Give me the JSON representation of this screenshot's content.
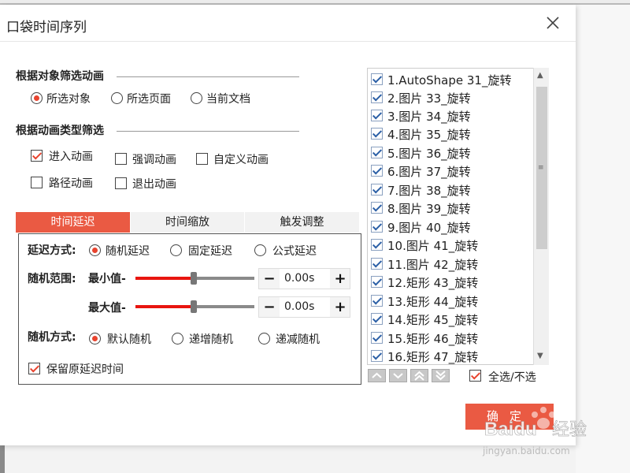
{
  "dialog": {
    "title": "口袋时间序列"
  },
  "filter_object": {
    "title": "根据对象筛选动画",
    "options": [
      "所选对象",
      "所选页面",
      "当前文档"
    ],
    "selected_index": 0
  },
  "filter_type": {
    "title": "根据动画类型筛选",
    "options": [
      {
        "label": "进入动画",
        "checked": true
      },
      {
        "label": "强调动画",
        "checked": false
      },
      {
        "label": "自定义动画",
        "checked": false
      },
      {
        "label": "路径动画",
        "checked": false
      },
      {
        "label": "退出动画",
        "checked": false
      }
    ]
  },
  "tabs": [
    {
      "label": "时间延迟",
      "active": true
    },
    {
      "label": "时间缩放",
      "active": false
    },
    {
      "label": "触发调整",
      "active": false
    }
  ],
  "delay_panel": {
    "delay_mode_label": "延迟方式:",
    "delay_modes": [
      "随机延迟",
      "固定延迟",
      "公式延迟"
    ],
    "delay_mode_selected": 0,
    "range_label": "随机范围:",
    "min_label": "最小值-",
    "max_label": "最大值-",
    "min_value": "0.00s",
    "max_value": "0.00s",
    "min_slider_fraction": 0.5,
    "max_slider_fraction": 0.5,
    "minus": "−",
    "plus": "+",
    "random_mode_label": "随机方式:",
    "random_modes": [
      "默认随机",
      "递增随机",
      "递减随机"
    ],
    "random_mode_selected": 0,
    "keep_original_label": "保留原延迟时间",
    "keep_original_checked": true
  },
  "animation_list": {
    "items": [
      {
        "label": "1.AutoShape  31_旋转",
        "checked": true
      },
      {
        "label": "2.图片 33_旋转",
        "checked": true
      },
      {
        "label": "3.图片 34_旋转",
        "checked": true
      },
      {
        "label": "4.图片 35_旋转",
        "checked": true
      },
      {
        "label": "5.图片 36_旋转",
        "checked": true
      },
      {
        "label": "6.图片 37_旋转",
        "checked": true
      },
      {
        "label": "7.图片 38_旋转",
        "checked": true
      },
      {
        "label": "8.图片 39_旋转",
        "checked": true
      },
      {
        "label": "9.图片 40_旋转",
        "checked": true
      },
      {
        "label": "10.图片 41_旋转",
        "checked": true
      },
      {
        "label": "11.图片 42_旋转",
        "checked": true
      },
      {
        "label": "12.矩形 43_旋转",
        "checked": true
      },
      {
        "label": "13.矩形 44_旋转",
        "checked": true
      },
      {
        "label": "14.矩形 45_旋转",
        "checked": true
      },
      {
        "label": "15.矩形 46_旋转",
        "checked": true
      },
      {
        "label": "16.矩形 47_旋转",
        "checked": true
      }
    ],
    "select_all_label": "全选/不选",
    "select_all_checked": true
  },
  "footer": {
    "ok_label": "确定"
  },
  "watermark": {
    "brand": "Baidu",
    "cn": "经验",
    "url": "jingyan.baidu.com"
  },
  "colors": {
    "accent": "#ea5a43",
    "slider_fill": "#e8150f"
  }
}
